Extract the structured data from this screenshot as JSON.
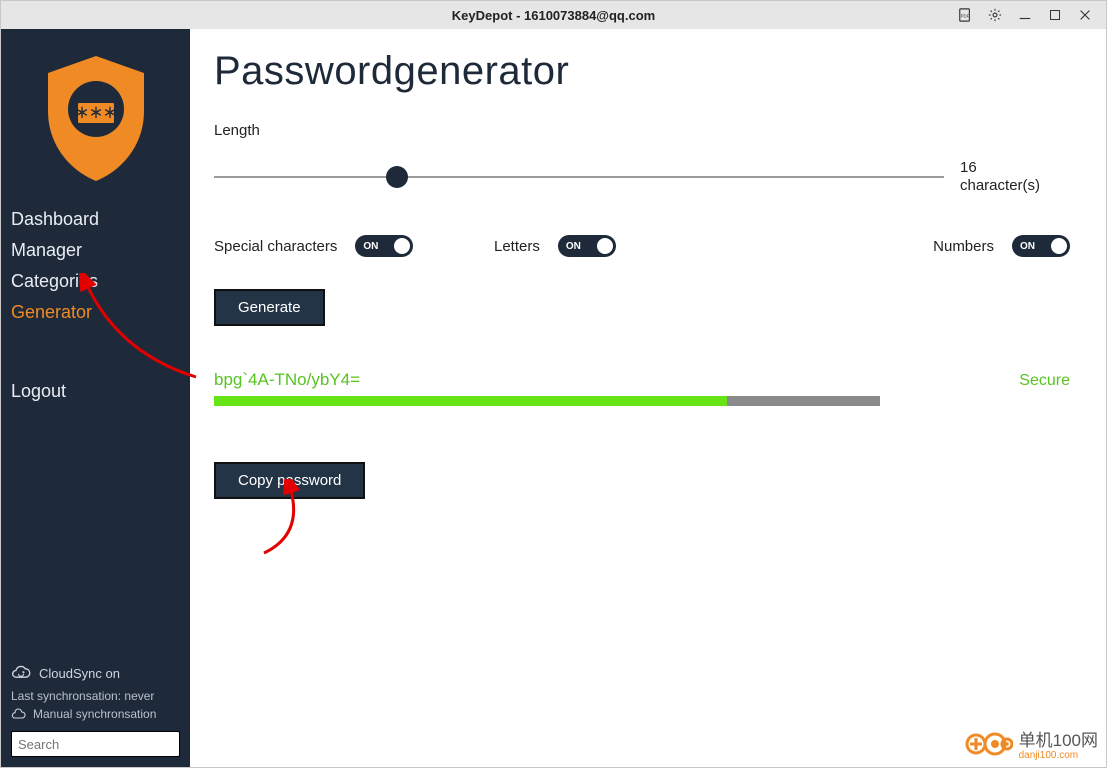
{
  "titlebar": {
    "title": "KeyDepot - 1610073884@qq.com"
  },
  "sidebar": {
    "nav": [
      {
        "label": "Dashboard",
        "active": false
      },
      {
        "label": "Manager",
        "active": false
      },
      {
        "label": "Categories",
        "active": false
      },
      {
        "label": "Generator",
        "active": true
      }
    ],
    "logout": "Logout",
    "cloudsync": "CloudSync on",
    "last_sync": "Last synchronsation: never",
    "manual_sync": "Manual synchronsation",
    "search_placeholder": "Search"
  },
  "main": {
    "title": "Passwordgenerator",
    "length_label": "Length",
    "length_value": "16",
    "length_unit": "character(s)",
    "slider_percent": 25,
    "toggles": {
      "special_label": "Special characters",
      "special_state": "ON",
      "letters_label": "Letters",
      "letters_state": "ON",
      "numbers_label": "Numbers",
      "numbers_state": "ON"
    },
    "generate_btn": "Generate",
    "password": "bpg`4A-TNo/ybY4=",
    "strength_label": "Secure",
    "strength_percent": 77,
    "copy_btn": "Copy password"
  },
  "watermark": {
    "line1": "单机100网",
    "line2": "danji100.com"
  },
  "colors": {
    "sidebar_bg": "#1e2a3a",
    "accent": "#f08a24",
    "strength": "#67e416"
  }
}
